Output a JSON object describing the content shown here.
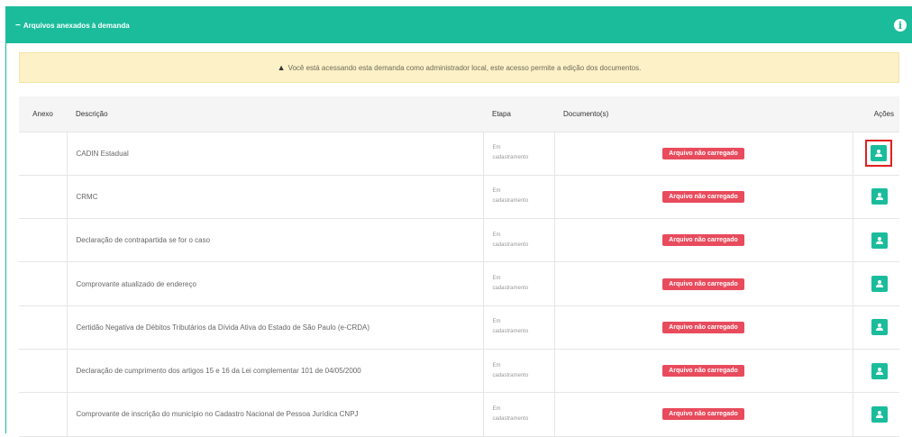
{
  "panel": {
    "title": "Arquivos anexados à demanda",
    "collapse_icon": "minus-icon",
    "info_icon": "info-icon"
  },
  "alert": {
    "icon": "warning-icon",
    "text": "Você está acessando esta demanda como administrador local, este acesso permite a edição dos documentos."
  },
  "table": {
    "headers": {
      "anexo": "Anexo",
      "descricao": "Descrição",
      "etapa": "Etapa",
      "documentos": "Documento(s)",
      "acoes": "Ações"
    },
    "rows": [
      {
        "descricao": "CADIN Estadual",
        "etapa_l1": "Em",
        "etapa_l2": "cadastramento",
        "status": "Arquivo não carregado"
      },
      {
        "descricao": "CRMC",
        "etapa_l1": "Em",
        "etapa_l2": "cadastramento",
        "status": "Arquivo não carregado"
      },
      {
        "descricao": "Declaração de contrapartida se for o caso",
        "etapa_l1": "Em",
        "etapa_l2": "cadastramento",
        "status": "Arquivo não carregado"
      },
      {
        "descricao": "Comprovante atualizado de endereço",
        "etapa_l1": "Em",
        "etapa_l2": "cadastramento",
        "status": "Arquivo não carregado"
      },
      {
        "descricao": "Certidão Negativa de Débitos Tributários da Dívida Ativa do Estado de São Paulo (e-CRDA)",
        "etapa_l1": "Em",
        "etapa_l2": "cadastramento",
        "status": "Arquivo não carregado"
      },
      {
        "descricao": "Declaração de cumprimento dos artigos 15 e 16 da Lei complementar 101 de 04/05/2000",
        "etapa_l1": "Em",
        "etapa_l2": "cadastramento",
        "status": "Arquivo não carregado"
      },
      {
        "descricao": "Comprovante de inscrição do município no Cadastro Nacional de Pessoa Jurídica CNPJ",
        "etapa_l1": "Em",
        "etapa_l2": "cadastramento",
        "status": "Arquivo não carregado"
      }
    ],
    "action_icon": "upload-icon"
  },
  "colors": {
    "accent": "#1abc9c",
    "badge": "#e84b5c",
    "alert_bg": "#fcf1c7",
    "highlight": "#e02020"
  }
}
